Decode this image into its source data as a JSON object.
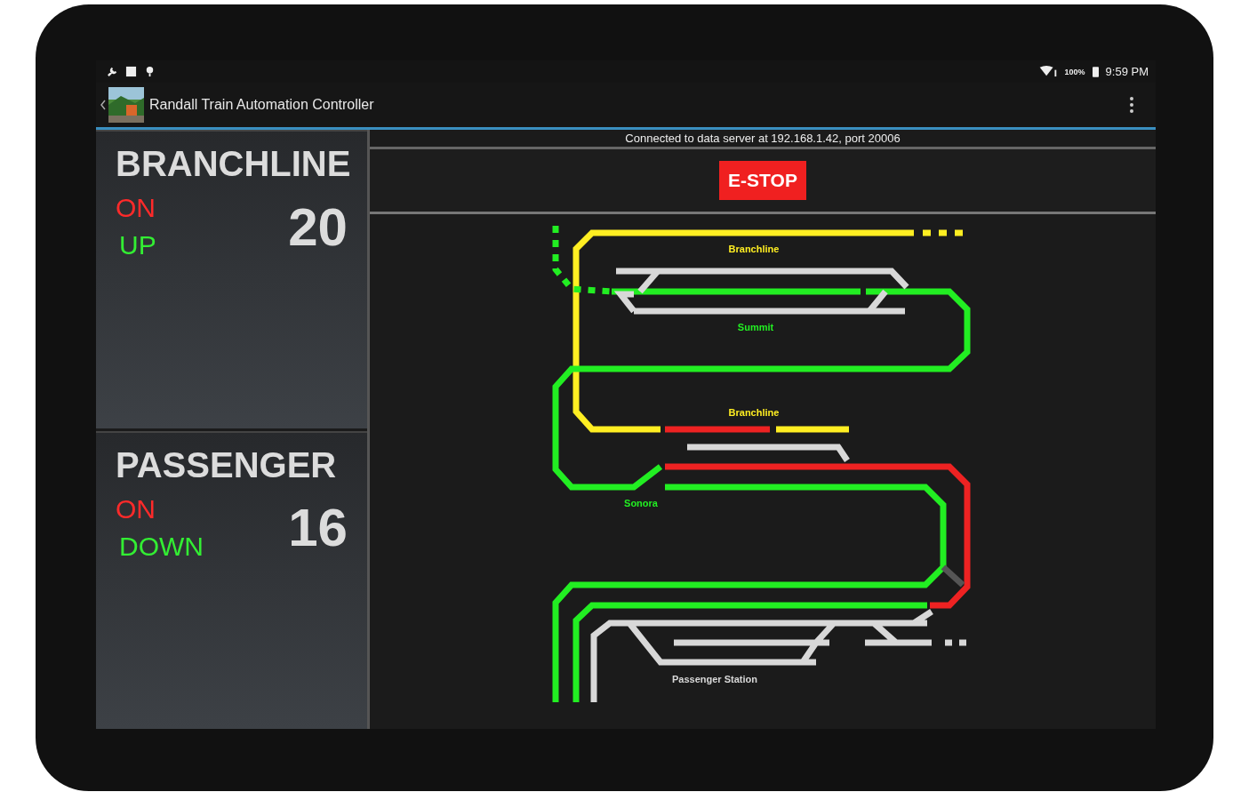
{
  "status_bar": {
    "battery": "100%",
    "time": "9:59 PM"
  },
  "app_bar": {
    "title": "Randall Train Automation Controller"
  },
  "trains": [
    {
      "name": "BRANCHLINE",
      "power": "ON",
      "direction": "UP",
      "number": "20"
    },
    {
      "name": "PASSENGER",
      "power": "ON",
      "direction": "DOWN",
      "number": "16"
    }
  ],
  "connection": "Connected to data server at 192.168.1.42, port 20006",
  "estop": "E-STOP",
  "track_map": {
    "labels": [
      {
        "text": "Branchline",
        "kind": "branch"
      },
      {
        "text": "Summit",
        "kind": "station"
      },
      {
        "text": "Branchline",
        "kind": "branch"
      },
      {
        "text": "Sonora",
        "kind": "station"
      },
      {
        "text": "Passenger Station",
        "kind": "yard"
      }
    ]
  }
}
